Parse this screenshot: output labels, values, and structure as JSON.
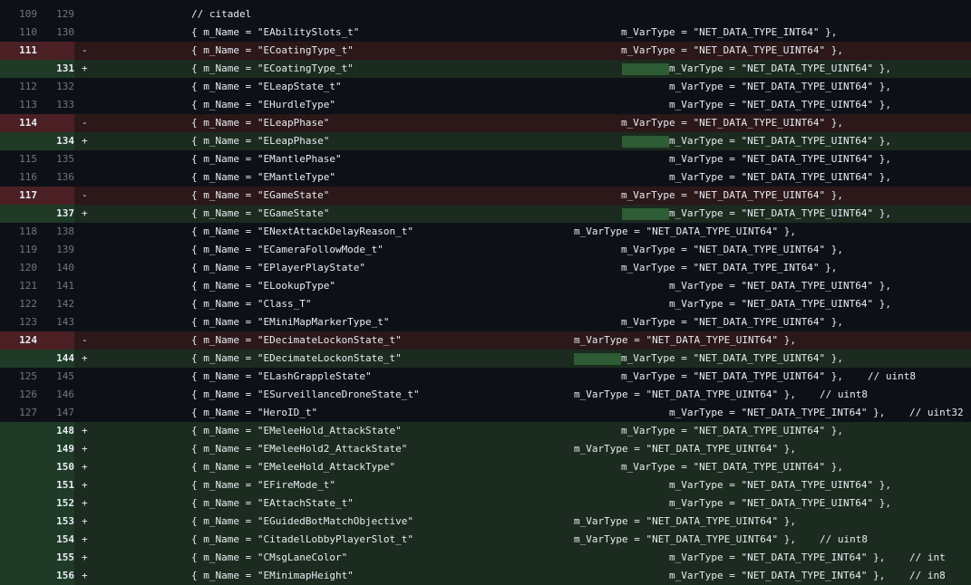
{
  "diff": {
    "rows": [
      {
        "type": "ctx",
        "old": "109",
        "new": "129",
        "marker": "",
        "parts": [
          {
            "t": "// citadel",
            "c": 211
          }
        ]
      },
      {
        "type": "ctx",
        "old": "110",
        "new": "130",
        "marker": "",
        "parts": [
          {
            "t": "{ m_Name = \"EAbilitySlots_t\"",
            "c": 211
          },
          {
            "t": "m_VarType = \"NET_DATA_TYPE_INT64\" },",
            "c": 685
          }
        ]
      },
      {
        "type": "del",
        "old": "111",
        "new": "",
        "marker": "-",
        "parts": [
          {
            "t": "{ m_Name = \"ECoatingType_t\"",
            "c": 211
          },
          {
            "t": "m_VarType = \"NET_DATA_TYPE_UINT64\" },",
            "c": 685
          }
        ]
      },
      {
        "type": "add",
        "old": "",
        "new": "131",
        "marker": "+",
        "hl": [
          686,
          738
        ],
        "parts": [
          {
            "t": "{ m_Name = \"ECoatingType_t\"",
            "c": 211
          },
          {
            "t": "m_VarType = \"NET_DATA_TYPE_UINT64\" },",
            "c": 738
          }
        ]
      },
      {
        "type": "ctx",
        "old": "112",
        "new": "132",
        "marker": "",
        "parts": [
          {
            "t": "{ m_Name = \"ELeapState_t\"",
            "c": 211
          },
          {
            "t": "m_VarType = \"NET_DATA_TYPE_UINT64\" },",
            "c": 738
          }
        ]
      },
      {
        "type": "ctx",
        "old": "113",
        "new": "133",
        "marker": "",
        "parts": [
          {
            "t": "{ m_Name = \"EHurdleType\"",
            "c": 211
          },
          {
            "t": "m_VarType = \"NET_DATA_TYPE_UINT64\" },",
            "c": 738
          }
        ]
      },
      {
        "type": "del",
        "old": "114",
        "new": "",
        "marker": "-",
        "parts": [
          {
            "t": "{ m_Name = \"ELeapPhase\"",
            "c": 211
          },
          {
            "t": "m_VarType = \"NET_DATA_TYPE_UINT64\" },",
            "c": 685
          }
        ]
      },
      {
        "type": "add",
        "old": "",
        "new": "134",
        "marker": "+",
        "hl": [
          686,
          738
        ],
        "parts": [
          {
            "t": "{ m_Name = \"ELeapPhase\"",
            "c": 211
          },
          {
            "t": "m_VarType = \"NET_DATA_TYPE_UINT64\" },",
            "c": 738
          }
        ]
      },
      {
        "type": "ctx",
        "old": "115",
        "new": "135",
        "marker": "",
        "parts": [
          {
            "t": "{ m_Name = \"EMantlePhase\"",
            "c": 211
          },
          {
            "t": "m_VarType = \"NET_DATA_TYPE_UINT64\" },",
            "c": 738
          }
        ]
      },
      {
        "type": "ctx",
        "old": "116",
        "new": "136",
        "marker": "",
        "parts": [
          {
            "t": "{ m_Name = \"EMantleType\"",
            "c": 211
          },
          {
            "t": "m_VarType = \"NET_DATA_TYPE_UINT64\" },",
            "c": 738
          }
        ]
      },
      {
        "type": "del",
        "old": "117",
        "new": "",
        "marker": "-",
        "parts": [
          {
            "t": "{ m_Name = \"EGameState\"",
            "c": 211
          },
          {
            "t": "m_VarType = \"NET_DATA_TYPE_UINT64\" },",
            "c": 685
          }
        ]
      },
      {
        "type": "add",
        "old": "",
        "new": "137",
        "marker": "+",
        "hl": [
          686,
          738
        ],
        "parts": [
          {
            "t": "{ m_Name = \"EGameState\"",
            "c": 211
          },
          {
            "t": "m_VarType = \"NET_DATA_TYPE_UINT64\" },",
            "c": 738
          }
        ]
      },
      {
        "type": "ctx",
        "old": "118",
        "new": "138",
        "marker": "",
        "parts": [
          {
            "t": "{ m_Name = \"ENextAttackDelayReason_t\"",
            "c": 211
          },
          {
            "t": "m_VarType = \"NET_DATA_TYPE_UINT64\" },",
            "c": 633
          }
        ]
      },
      {
        "type": "ctx",
        "old": "119",
        "new": "139",
        "marker": "",
        "parts": [
          {
            "t": "{ m_Name = \"ECameraFollowMode_t\"",
            "c": 211
          },
          {
            "t": "m_VarType = \"NET_DATA_TYPE_UINT64\" },",
            "c": 685
          }
        ]
      },
      {
        "type": "ctx",
        "old": "120",
        "new": "140",
        "marker": "",
        "parts": [
          {
            "t": "{ m_Name = \"EPlayerPlayState\"",
            "c": 211
          },
          {
            "t": "m_VarType = \"NET_DATA_TYPE_INT64\" },",
            "c": 685
          }
        ]
      },
      {
        "type": "ctx",
        "old": "121",
        "new": "141",
        "marker": "",
        "parts": [
          {
            "t": "{ m_Name = \"ELookupType\"",
            "c": 211
          },
          {
            "t": "m_VarType = \"NET_DATA_TYPE_UINT64\" },",
            "c": 738
          }
        ]
      },
      {
        "type": "ctx",
        "old": "122",
        "new": "142",
        "marker": "",
        "parts": [
          {
            "t": "{ m_Name = \"Class_T\"",
            "c": 211
          },
          {
            "t": "m_VarType = \"NET_DATA_TYPE_UINT64\" },",
            "c": 738
          }
        ]
      },
      {
        "type": "ctx",
        "old": "123",
        "new": "143",
        "marker": "",
        "parts": [
          {
            "t": "{ m_Name = \"EMiniMapMarkerType_t\"",
            "c": 211
          },
          {
            "t": "m_VarType = \"NET_DATA_TYPE_UINT64\" },",
            "c": 685
          }
        ]
      },
      {
        "type": "del",
        "old": "124",
        "new": "",
        "marker": "-",
        "parts": [
          {
            "t": "{ m_Name = \"EDecimateLockonState_t\"",
            "c": 211
          },
          {
            "t": "m_VarType = \"NET_DATA_TYPE_UINT64\" },",
            "c": 633
          }
        ]
      },
      {
        "type": "add",
        "old": "",
        "new": "144",
        "marker": "+",
        "hl": [
          633,
          685
        ],
        "parts": [
          {
            "t": "{ m_Name = \"EDecimateLockonState_t\"",
            "c": 211
          },
          {
            "t": "m_VarType = \"NET_DATA_TYPE_UINT64\" },",
            "c": 685
          }
        ]
      },
      {
        "type": "ctx",
        "old": "125",
        "new": "145",
        "marker": "",
        "parts": [
          {
            "t": "{ m_Name = \"ELashGrappleState\"",
            "c": 211
          },
          {
            "t": "m_VarType = \"NET_DATA_TYPE_UINT64\" },",
            "c": 685
          },
          {
            "t": "// uint8",
            "c": 957
          }
        ]
      },
      {
        "type": "ctx",
        "old": "126",
        "new": "146",
        "marker": "",
        "parts": [
          {
            "t": "{ m_Name = \"ESurveillanceDroneState_t\"",
            "c": 211
          },
          {
            "t": "m_VarType = \"NET_DATA_TYPE_UINT64\" },",
            "c": 633
          },
          {
            "t": "// uint8",
            "c": 904
          }
        ]
      },
      {
        "type": "ctx",
        "old": "127",
        "new": "147",
        "marker": "",
        "parts": [
          {
            "t": "{ m_Name = \"HeroID_t\"",
            "c": 211
          },
          {
            "t": "m_VarType = \"NET_DATA_TYPE_INT64\" },",
            "c": 738
          },
          {
            "t": "// uint32",
            "c": 1003
          }
        ]
      },
      {
        "type": "add",
        "old": "",
        "new": "148",
        "marker": "+",
        "parts": [
          {
            "t": "{ m_Name = \"EMeleeHold_AttackState\"",
            "c": 211
          },
          {
            "t": "m_VarType = \"NET_DATA_TYPE_UINT64\" },",
            "c": 685
          }
        ]
      },
      {
        "type": "add",
        "old": "",
        "new": "149",
        "marker": "+",
        "parts": [
          {
            "t": "{ m_Name = \"EMeleeHold2_AttackState\"",
            "c": 211
          },
          {
            "t": "m_VarType = \"NET_DATA_TYPE_UINT64\" },",
            "c": 633
          }
        ]
      },
      {
        "type": "add",
        "old": "",
        "new": "150",
        "marker": "+",
        "parts": [
          {
            "t": "{ m_Name = \"EMeleeHold_AttackType\"",
            "c": 211
          },
          {
            "t": "m_VarType = \"NET_DATA_TYPE_UINT64\" },",
            "c": 685
          }
        ]
      },
      {
        "type": "add",
        "old": "",
        "new": "151",
        "marker": "+",
        "parts": [
          {
            "t": "{ m_Name = \"EFireMode_t\"",
            "c": 211
          },
          {
            "t": "m_VarType = \"NET_DATA_TYPE_UINT64\" },",
            "c": 738
          }
        ]
      },
      {
        "type": "add",
        "old": "",
        "new": "152",
        "marker": "+",
        "parts": [
          {
            "t": "{ m_Name = \"EAttachState_t\"",
            "c": 211
          },
          {
            "t": "m_VarType = \"NET_DATA_TYPE_UINT64\" },",
            "c": 738
          }
        ]
      },
      {
        "type": "add",
        "old": "",
        "new": "153",
        "marker": "+",
        "parts": [
          {
            "t": "{ m_Name = \"EGuidedBotMatchObjective\"",
            "c": 211
          },
          {
            "t": "m_VarType = \"NET_DATA_TYPE_UINT64\" },",
            "c": 633
          }
        ]
      },
      {
        "type": "add",
        "old": "",
        "new": "154",
        "marker": "+",
        "parts": [
          {
            "t": "{ m_Name = \"CitadelLobbyPlayerSlot_t\"",
            "c": 211
          },
          {
            "t": "m_VarType = \"NET_DATA_TYPE_UINT64\" },",
            "c": 633
          },
          {
            "t": "// uint8",
            "c": 904
          }
        ]
      },
      {
        "type": "add",
        "old": "",
        "new": "155",
        "marker": "+",
        "parts": [
          {
            "t": "{ m_Name = \"CMsgLaneColor\"",
            "c": 211
          },
          {
            "t": "m_VarType = \"NET_DATA_TYPE_INT64\" },",
            "c": 738
          },
          {
            "t": "// int",
            "c": 1003
          }
        ]
      },
      {
        "type": "add",
        "old": "",
        "new": "156",
        "marker": "+",
        "parts": [
          {
            "t": "{ m_Name = \"EMinimapHeight\"",
            "c": 211
          },
          {
            "t": "m_VarType = \"NET_DATA_TYPE_INT64\" },",
            "c": 738
          },
          {
            "t": "// in8",
            "c": 1003
          }
        ]
      }
    ]
  }
}
